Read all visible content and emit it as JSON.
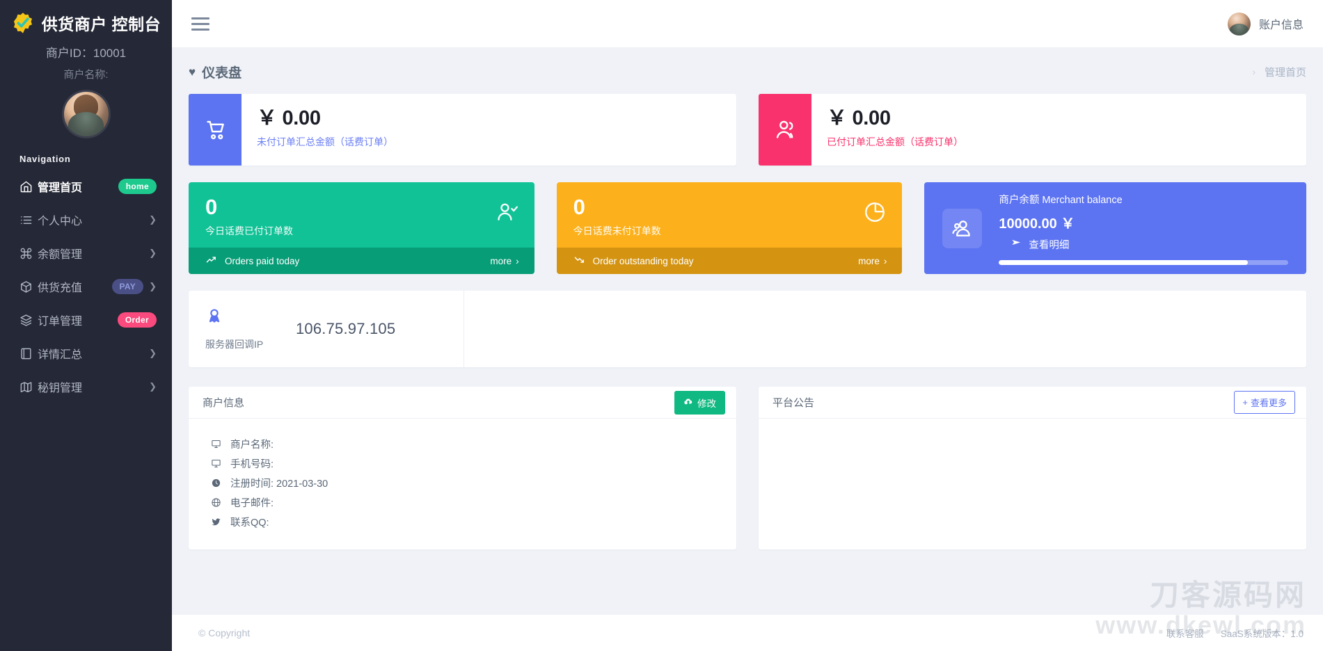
{
  "sidebar": {
    "brand_title": "供货商户 控制台",
    "brand_logo_icon": "badge-check-icon",
    "merchant_id_label": "商户ID：10001",
    "merchant_name_label": "商户名称:",
    "avatar_icon": "user-avatar",
    "nav_title": "Navigation",
    "items": [
      {
        "label": "管理首页",
        "icon": "home-icon",
        "badge": "home",
        "badge_type": "home",
        "chevron": false,
        "active": true
      },
      {
        "label": "个人中心",
        "icon": "list-icon",
        "badge": "",
        "badge_type": "",
        "chevron": true,
        "active": false
      },
      {
        "label": "余额管理",
        "icon": "command-icon",
        "badge": "",
        "badge_type": "",
        "chevron": true,
        "active": false
      },
      {
        "label": "供货充值",
        "icon": "box-icon",
        "badge": "PAY",
        "badge_type": "pay",
        "chevron": true,
        "active": false
      },
      {
        "label": "订单管理",
        "icon": "layers-icon",
        "badge": "Order",
        "badge_type": "order",
        "chevron": false,
        "active": false
      },
      {
        "label": "详情汇总",
        "icon": "book-icon",
        "badge": "",
        "badge_type": "",
        "chevron": true,
        "active": false
      },
      {
        "label": "秘钥管理",
        "icon": "map-icon",
        "badge": "",
        "badge_type": "",
        "chevron": true,
        "active": false
      }
    ]
  },
  "topbar": {
    "menu_icon": "hamburger-icon",
    "account_label": "账户信息",
    "account_avatar_icon": "user-avatar"
  },
  "page": {
    "title": "仪表盘",
    "title_icon": "heart-icon",
    "breadcrumb_arrow": "›",
    "breadcrumb": "管理首页"
  },
  "stats_wide": [
    {
      "icon": "shopping-cart-icon",
      "amount": "￥ 0.00",
      "caption": "未付订单汇总金额（话费订单）",
      "icon_bg": "#5c73f2",
      "caption_color": "#6b7ff5"
    },
    {
      "icon": "users-icon",
      "amount": "￥ 0.00",
      "caption": "已付订单汇总金额（话费订单）",
      "icon_bg": "#f9316c",
      "caption_color": "#f9316c"
    }
  ],
  "tiles": [
    {
      "number": "0",
      "caption": "今日话费已付订单数",
      "glyph": "user-check-icon",
      "foot_icon": "trend-up-icon",
      "foot_label": "Orders paid today",
      "more_label": "more",
      "more_arrow": "›",
      "color": "#10c296",
      "foot_color": "#079d77"
    },
    {
      "number": "0",
      "caption": "今日话费未付订单数",
      "glyph": "pie-chart-icon",
      "foot_icon": "trend-down-icon",
      "foot_label": "Order outstanding today",
      "more_label": "more",
      "more_arrow": "›",
      "color": "#fcb11c",
      "foot_color": "#d49412"
    }
  ],
  "balance": {
    "icon": "users-group-icon",
    "label": "商户余额 Merchant balance",
    "value": "10000.00 ￥",
    "link_icon": "send-icon",
    "link_label": "查看明细",
    "progress_percent": 86,
    "color": "#5c73f2"
  },
  "ip_card": {
    "icon": "award-icon",
    "label": "服务器回调IP",
    "value": "106.75.97.105"
  },
  "merchant_panel": {
    "title": "商户信息",
    "edit_icon": "cloud-upload-icon",
    "edit_label": "修改",
    "rows": [
      {
        "icon": "monitor-icon",
        "text": "商户名称:"
      },
      {
        "icon": "monitor-icon",
        "text": "手机号码:"
      },
      {
        "icon": "clock-icon",
        "text": "注册时间: 2021-03-30"
      },
      {
        "icon": "globe-icon",
        "text": "电子邮件:"
      },
      {
        "icon": "twitter-icon",
        "text": "联系QQ:"
      }
    ]
  },
  "announcement_panel": {
    "title": "平台公告",
    "more_icon": "plus-icon",
    "more_label": "查看更多"
  },
  "footer": {
    "copyright": "© Copyright",
    "support_label": "联系客服",
    "version_label": "SaaS系统版本：1.0"
  },
  "watermark": {
    "line1": "刀客源码网",
    "line2": "www.dkewl.com"
  }
}
